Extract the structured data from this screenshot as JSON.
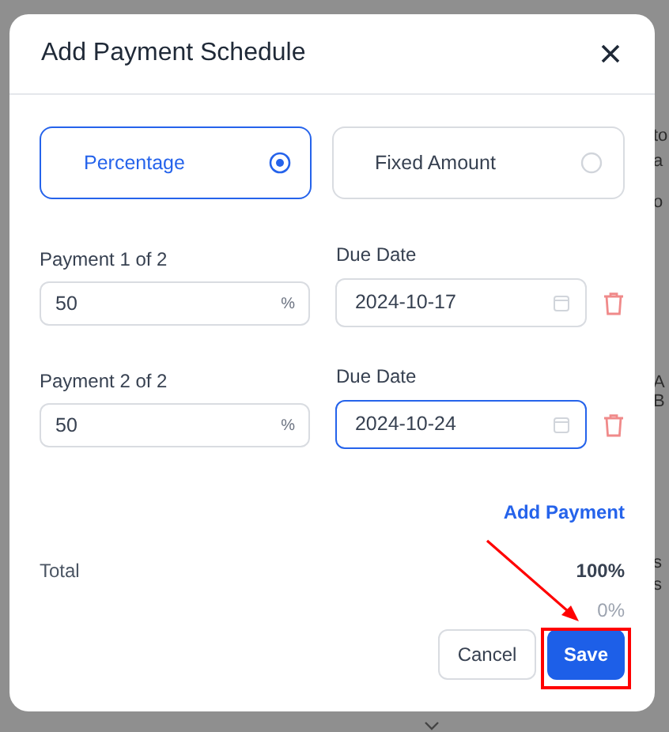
{
  "background": {
    "fragments": [
      "to",
      "a",
      "o",
      "A",
      "B",
      "s",
      "s"
    ]
  },
  "dialog": {
    "title": "Add Payment Schedule",
    "options": [
      {
        "label": "Percentage",
        "selected": true
      },
      {
        "label": "Fixed Amount",
        "selected": false
      }
    ],
    "payments": [
      {
        "label": "Payment 1 of 2",
        "value": "50",
        "unit": "%",
        "date_label": "Due Date",
        "date": "2024-10-17",
        "focused": false
      },
      {
        "label": "Payment 2 of 2",
        "value": "50",
        "unit": "%",
        "date_label": "Due Date",
        "date": "2024-10-24",
        "focused": true
      }
    ],
    "add_link": "Add Payment",
    "total_label": "Total",
    "total_value": "100%",
    "remaining": "0%",
    "buttons": [
      {
        "label": "Cancel",
        "kind": "secondary"
      },
      {
        "label": "Save",
        "kind": "primary"
      }
    ]
  }
}
